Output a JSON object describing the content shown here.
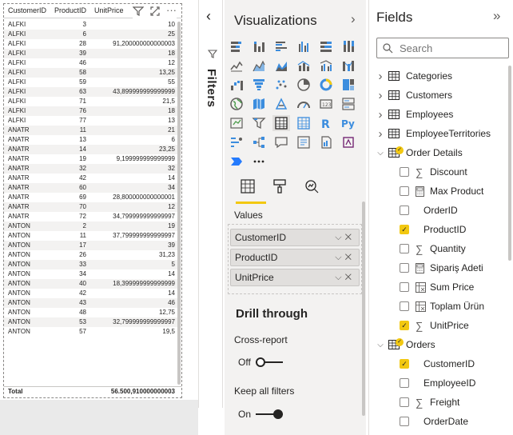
{
  "table_visual": {
    "columns": [
      "CustomerID",
      "ProductID",
      "UnitPrice"
    ],
    "rows": [
      [
        "ALFKI",
        "3",
        "10"
      ],
      [
        "ALFKI",
        "6",
        "25"
      ],
      [
        "ALFKI",
        "28",
        "91,200000000000003"
      ],
      [
        "ALFKI",
        "39",
        "18"
      ],
      [
        "ALFKI",
        "46",
        "12"
      ],
      [
        "ALFKI",
        "58",
        "13,25"
      ],
      [
        "ALFKI",
        "59",
        "55"
      ],
      [
        "ALFKI",
        "63",
        "43,899999999999999"
      ],
      [
        "ALFKI",
        "71",
        "21,5"
      ],
      [
        "ALFKI",
        "76",
        "18"
      ],
      [
        "ALFKI",
        "77",
        "13"
      ],
      [
        "ANATR",
        "11",
        "21"
      ],
      [
        "ANATR",
        "13",
        "6"
      ],
      [
        "ANATR",
        "14",
        "23,25"
      ],
      [
        "ANATR",
        "19",
        "9,199999999999999"
      ],
      [
        "ANATR",
        "32",
        "32"
      ],
      [
        "ANATR",
        "42",
        "14"
      ],
      [
        "ANATR",
        "60",
        "34"
      ],
      [
        "ANATR",
        "69",
        "28,800000000000001"
      ],
      [
        "ANATR",
        "70",
        "12"
      ],
      [
        "ANATR",
        "72",
        "34,799999999999997"
      ],
      [
        "ANTON",
        "2",
        "19"
      ],
      [
        "ANTON",
        "11",
        "37,799999999999997"
      ],
      [
        "ANTON",
        "17",
        "39"
      ],
      [
        "ANTON",
        "26",
        "31,23"
      ],
      [
        "ANTON",
        "33",
        "5"
      ],
      [
        "ANTON",
        "34",
        "14"
      ],
      [
        "ANTON",
        "40",
        "18,399999999999999"
      ],
      [
        "ANTON",
        "42",
        "14"
      ],
      [
        "ANTON",
        "43",
        "46"
      ],
      [
        "ANTON",
        "48",
        "12,75"
      ],
      [
        "ANTON",
        "53",
        "32,799999999999997"
      ],
      [
        "ANTON",
        "57",
        "19,5"
      ]
    ],
    "total_label": "Total",
    "total_value": "56.500,910000000003"
  },
  "filters": {
    "label": "Filters"
  },
  "visualizations": {
    "title": "Visualizations",
    "more": "···",
    "values_label": "Values",
    "wells": [
      "CustomerID",
      "ProductID",
      "UnitPrice"
    ],
    "drill_title": "Drill through",
    "cross_report_label": "Cross-report",
    "cross_report_state": "Off",
    "keep_filters_label": "Keep all filters",
    "keep_filters_state": "On"
  },
  "fields": {
    "title": "Fields",
    "search_placeholder": "Search",
    "items": [
      {
        "kind": "table",
        "label": "Categories",
        "expanded": false
      },
      {
        "kind": "table",
        "label": "Customers",
        "expanded": false
      },
      {
        "kind": "table",
        "label": "Employees",
        "expanded": false
      },
      {
        "kind": "table",
        "label": "EmployeeTerritories",
        "expanded": false
      },
      {
        "kind": "table",
        "label": "Order Details",
        "expanded": true,
        "badge": true
      },
      {
        "kind": "field",
        "label": "Discount",
        "icon": "sigma",
        "checked": false
      },
      {
        "kind": "field",
        "label": "Max Product",
        "icon": "calc",
        "checked": false
      },
      {
        "kind": "field",
        "label": "OrderID",
        "icon": "none",
        "checked": false
      },
      {
        "kind": "field",
        "label": "ProductID",
        "icon": "none",
        "checked": true
      },
      {
        "kind": "field",
        "label": "Quantity",
        "icon": "sigma",
        "checked": false
      },
      {
        "kind": "field",
        "label": "Sipariş Adeti",
        "icon": "calc",
        "checked": false
      },
      {
        "kind": "field",
        "label": "Sum Price",
        "icon": "measure",
        "checked": false
      },
      {
        "kind": "field",
        "label": "Toplam Ürün",
        "icon": "measure",
        "checked": false
      },
      {
        "kind": "field",
        "label": "UnitPrice",
        "icon": "sigma",
        "checked": true
      },
      {
        "kind": "table",
        "label": "Orders",
        "expanded": true,
        "badge": true
      },
      {
        "kind": "field",
        "label": "CustomerID",
        "icon": "none",
        "checked": true
      },
      {
        "kind": "field",
        "label": "EmployeeID",
        "icon": "none",
        "checked": false
      },
      {
        "kind": "field",
        "label": "Freight",
        "icon": "sigma",
        "checked": false
      },
      {
        "kind": "field",
        "label": "OrderDate",
        "icon": "none",
        "checked": false
      }
    ]
  },
  "accent_color": "#f2c811"
}
